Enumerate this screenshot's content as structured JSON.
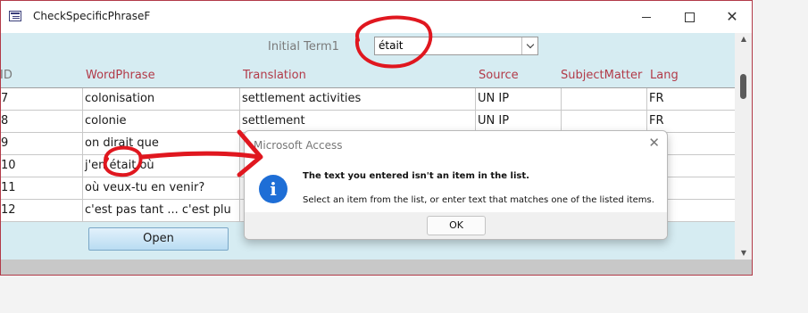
{
  "window": {
    "title": "CheckSpecificPhraseF",
    "icon": "form-icon",
    "controls": {
      "minimize": "minimize-icon",
      "maximize": "maximize-icon",
      "close": "✕"
    }
  },
  "form": {
    "term_label": "Initial Term1",
    "term_value": "était",
    "columns": [
      "ID",
      "WordPhrase",
      "Translation",
      "Source",
      "SubjectMatter",
      "Lang"
    ],
    "rows": [
      {
        "id": "7",
        "word_phrase": "colonisation",
        "translation": "settlement activities",
        "source": "UN IP",
        "subject_matter": "",
        "lang": "FR"
      },
      {
        "id": "8",
        "word_phrase": "colonie",
        "translation": "settlement",
        "source": "UN IP",
        "subject_matter": "",
        "lang": "FR"
      },
      {
        "id": "9",
        "word_phrase": "on dirait que",
        "translation": "",
        "source": "",
        "subject_matter": "",
        "lang": ""
      },
      {
        "id": "10",
        "word_phrase": "j'en était où",
        "translation": "",
        "source": "",
        "subject_matter": "",
        "lang": ""
      },
      {
        "id": "11",
        "word_phrase": "où veux-tu en venir?",
        "translation": "",
        "source": "",
        "subject_matter": "",
        "lang": ""
      },
      {
        "id": "12",
        "word_phrase": "c'est pas tant ... c'est plu",
        "translation": "",
        "source": "",
        "subject_matter": "",
        "lang": ""
      }
    ],
    "open_button": "Open"
  },
  "dialog": {
    "title": "Microsoft Access",
    "close": "✕",
    "icon": "info-icon",
    "icon_glyph": "i",
    "message": "The text you entered isn't an item in the list.",
    "detail": "Select an item from the list, or enter text that matches one of the listed items.",
    "ok_button": "OK"
  },
  "colors": {
    "form_background": "#d6ecf2",
    "header_red": "#b23a48",
    "annotation_red": "#e0171f",
    "info_blue": "#1e6ed6"
  }
}
